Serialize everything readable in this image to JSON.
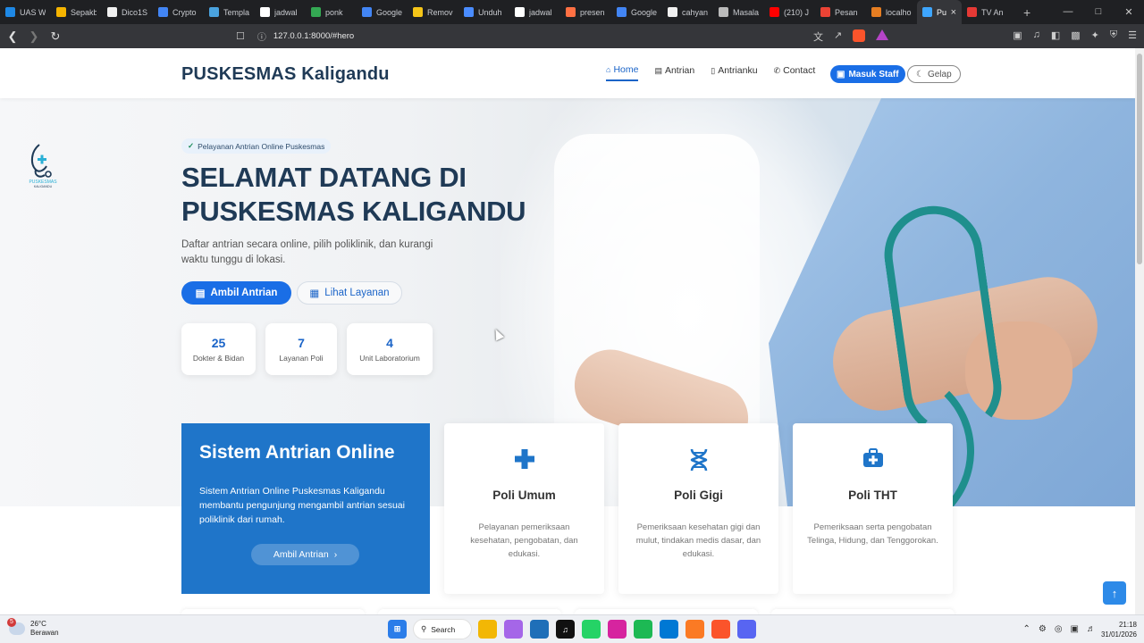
{
  "browser": {
    "tabs": [
      {
        "label": "UAS W",
        "color": "#1e88e5"
      },
      {
        "label": "Sepakb",
        "color": "#f5b400"
      },
      {
        "label": "Dico1S",
        "color": "#f0f0f0"
      },
      {
        "label": "Crypto",
        "color": "#4285f4"
      },
      {
        "label": "Templa",
        "color": "#4aa3df"
      },
      {
        "label": "jadwal",
        "color": "#ffffff"
      },
      {
        "label": "ponk",
        "color": "#34a853"
      },
      {
        "label": "Google",
        "color": "#4285f4"
      },
      {
        "label": "Remov",
        "color": "#f5c518"
      },
      {
        "label": "Unduh",
        "color": "#4a8cff"
      },
      {
        "label": "jadwal",
        "color": "#ffffff"
      },
      {
        "label": "presen",
        "color": "#ff7043"
      },
      {
        "label": "Google",
        "color": "#4285f4"
      },
      {
        "label": "cahyan",
        "color": "#f0f0f0"
      },
      {
        "label": "Masala",
        "color": "#bbbbbb"
      },
      {
        "label": "(210) J",
        "color": "#ff0000"
      },
      {
        "label": "Pesan",
        "color": "#ea4335"
      },
      {
        "label": "localho",
        "color": "#e67e22"
      },
      {
        "label": "Pu",
        "color": "#3ea6ff",
        "active": true
      },
      {
        "label": "TV An",
        "color": "#e53935"
      }
    ],
    "url": "127.0.0.1:8000/#hero"
  },
  "header": {
    "brand": "PUSKESMAS Kaligandu",
    "nav": [
      {
        "label": "Home",
        "icon": "home-icon",
        "active": true
      },
      {
        "label": "Antrian",
        "icon": "ticket-icon"
      },
      {
        "label": "Antrianku",
        "icon": "phone-icon"
      },
      {
        "label": "Contact",
        "icon": "telephone-icon"
      }
    ],
    "staff_btn": "Masuk Staff",
    "dark_btn": "Gelap"
  },
  "logo": {
    "line1": "PUSKESMAS",
    "line2": "KALIGANDU"
  },
  "hero": {
    "badge": "Pelayanan Antrian Online Puskesmas",
    "title_line1": "SELAMAT DATANG DI",
    "title_line2": "PUSKESMAS KALIGANDU",
    "subtitle": "Daftar antrian secara online, pilih poliklinik, dan kurangi waktu tunggu di lokasi.",
    "btn_primary": "Ambil Antrian",
    "btn_outline": "Lihat Layanan",
    "stats": [
      {
        "value": "25",
        "label": "Dokter & Bidan"
      },
      {
        "value": "7",
        "label": "Layanan Poli"
      },
      {
        "value": "4",
        "label": "Unit Laboratorium"
      }
    ]
  },
  "intro_card": {
    "title": "Sistem Antrian Online",
    "desc": "Sistem Antrian Online Puskesmas Kaligandu membantu pengunjung mengambil antrian sesuai poliklinik dari rumah.",
    "btn": "Ambil Antrian"
  },
  "services": [
    {
      "name": "Poli Umum",
      "icon": "plus-icon",
      "desc": "Pelayanan pemeriksaan kesehatan, pengobatan, dan edukasi."
    },
    {
      "name": "Poli Gigi",
      "icon": "dna-icon",
      "desc": "Pemeriksaan kesehatan gigi dan mulut, tindakan medis dasar, dan edukasi."
    },
    {
      "name": "Poli THT",
      "icon": "medkit-icon",
      "desc": "Pemeriksaan serta pengobatan Telinga, Hidung, dan Tenggorokan."
    }
  ],
  "taskbar": {
    "weather_temp": "26°C",
    "weather_desc": "Berawan",
    "weather_badge": "5",
    "search": "Search",
    "time": "21:18",
    "date": "31/01/2026"
  },
  "colors": {
    "primary": "#1a6ee6",
    "brand_dark": "#1f3a56",
    "card_blue": "#1f75c9"
  }
}
